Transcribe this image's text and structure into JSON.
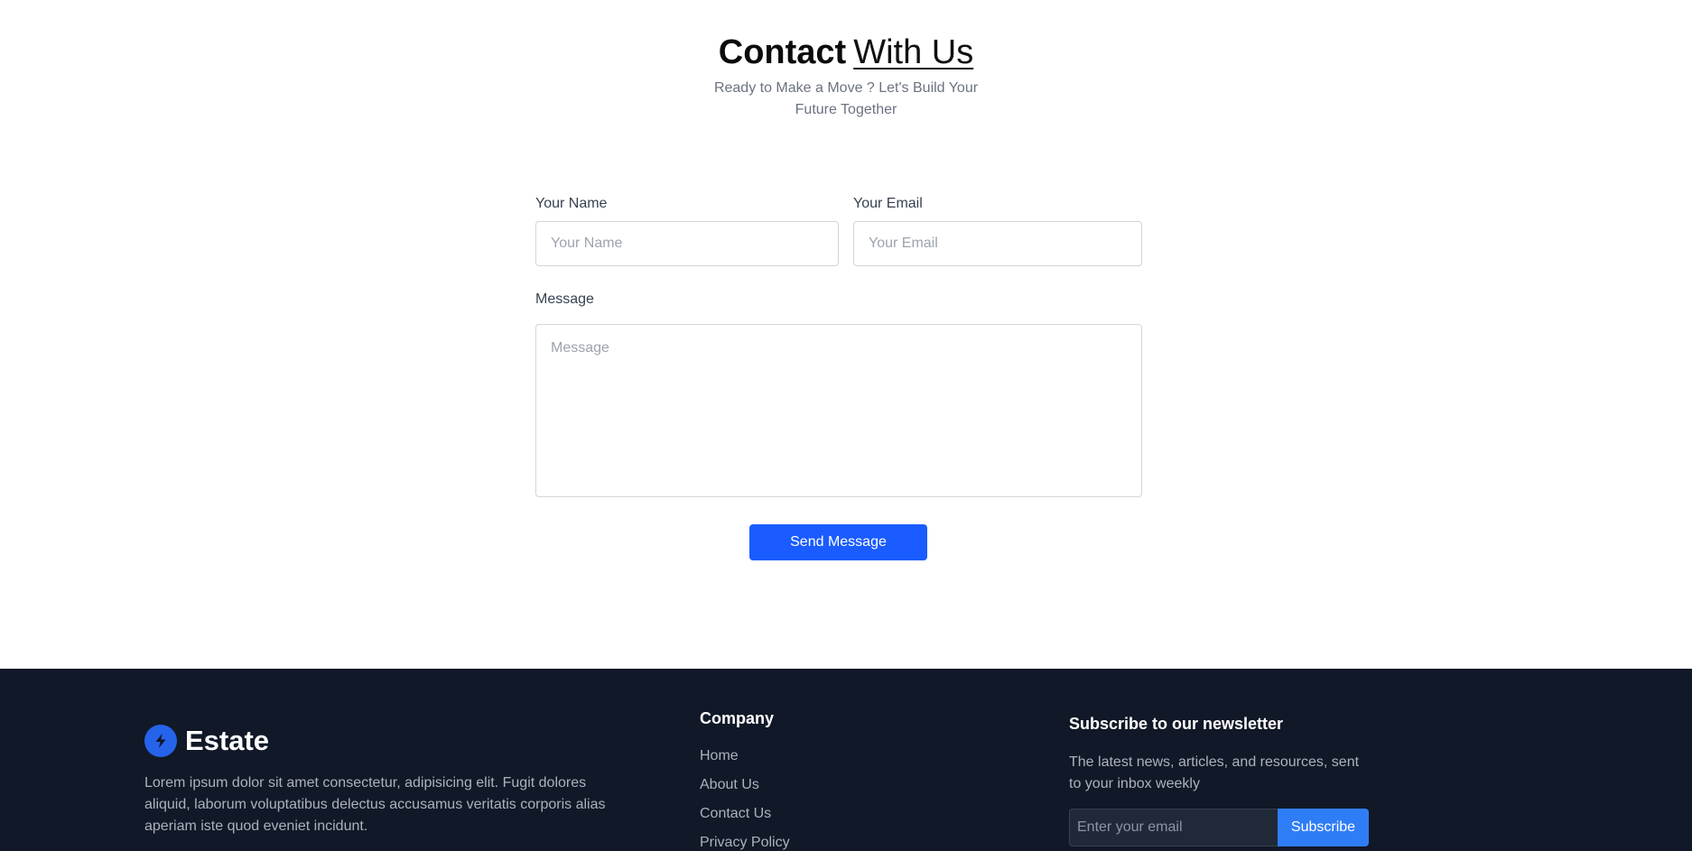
{
  "contact": {
    "title_bold": "Contact",
    "title_underlined": "With Us",
    "subtitle": "Ready to Make a Move ? Let's Build Your Future Together",
    "form": {
      "name_label": "Your Name",
      "name_placeholder": "Your Name",
      "email_label": "Your Email",
      "email_placeholder": "Your Email",
      "message_label": "Message",
      "message_placeholder": "Message",
      "submit_label": "Send Message"
    }
  },
  "footer": {
    "brand": {
      "name": "Estate",
      "icon": "lightning-bolt-icon",
      "description": "Lorem ipsum dolor sit amet consectetur, adipisicing elit. Fugit dolores aliquid, laborum voluptatibus delectus accusamus veritatis corporis alias aperiam iste quod eveniet incidunt."
    },
    "company": {
      "title": "Company",
      "links": [
        "Home",
        "About Us",
        "Contact Us",
        "Privacy Policy"
      ]
    },
    "newsletter": {
      "title": "Subscribe to our newsletter",
      "description": "The latest news, articles, and resources, sent to your inbox weekly",
      "input_placeholder": "Enter your email",
      "button_label": "Subscribe"
    }
  },
  "colors": {
    "primary_button": "#1a5cff",
    "footer_background": "#111827",
    "subscribe_button": "#2f7df6",
    "brand_icon": "#2563eb"
  }
}
